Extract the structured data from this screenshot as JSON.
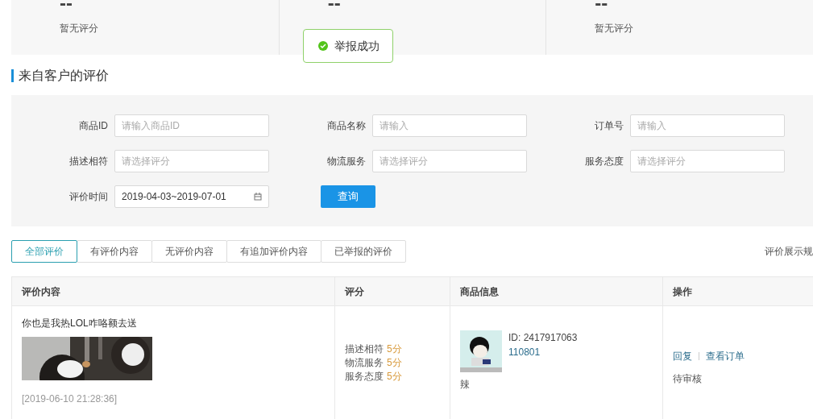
{
  "stats": [
    {
      "value": "--",
      "label": "暂无评分"
    },
    {
      "value": "--"
    },
    {
      "value": "--",
      "label": "暂无评分"
    }
  ],
  "toast": {
    "text": "举报成功"
  },
  "section_title": "来自客户的评价",
  "filters": [
    {
      "label": "商品ID",
      "placeholder": "请输入商品ID"
    },
    {
      "label": "商品名称",
      "placeholder": "请输入"
    },
    {
      "label": "订单号",
      "placeholder": "请输入"
    },
    {
      "label": "描述相符",
      "placeholder": "请选择评分"
    },
    {
      "label": "物流服务",
      "placeholder": "请选择评分"
    },
    {
      "label": "服务态度",
      "placeholder": "请选择评分"
    }
  ],
  "date_filter": {
    "label": "评价时间",
    "value": "2019-04-03~2019-07-01"
  },
  "query_button": "查询",
  "tabs": [
    {
      "label": "全部评价",
      "selected": true
    },
    {
      "label": "有评价内容",
      "selected": false
    },
    {
      "label": "无评价内容",
      "selected": false
    },
    {
      "label": "有追加评价内容",
      "selected": false
    },
    {
      "label": "已举报的评价",
      "selected": false
    }
  ],
  "rules_link": "评价展示规",
  "table": {
    "columns": [
      "评价内容",
      "评分",
      "商品信息",
      "操作"
    ],
    "rows": [
      {
        "comment": "你也是我热LOL咋咯额去送",
        "photo": {
          "kind": "picture"
        },
        "time": "[2019-06-10 21:28:36]",
        "scores": [
          {
            "label": "描述相符",
            "value": "5分"
          },
          {
            "label": "物流服务",
            "value": "5分"
          },
          {
            "label": "服务态度",
            "value": "5分"
          }
        ],
        "product_id": "ID: 2417917063",
        "product_code": "110801",
        "product_name": "辣",
        "actions": [
          "回复",
          "查看订单"
        ],
        "status": "待审核"
      }
    ]
  }
}
